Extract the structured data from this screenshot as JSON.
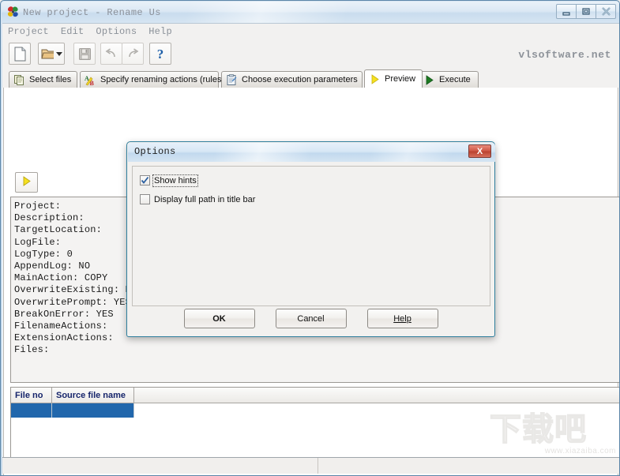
{
  "window": {
    "title": "New project - Rename Us",
    "icon": "app-butterfly-icon",
    "buttons": {
      "minimize": "minimize-icon",
      "maximize": "maximize-icon",
      "close": "close-icon"
    }
  },
  "menubar": {
    "items": [
      {
        "label": "Project"
      },
      {
        "label": "Edit"
      },
      {
        "label": "Options"
      },
      {
        "label": "Help"
      }
    ]
  },
  "toolbar": {
    "buttons": [
      {
        "name": "new-project-button",
        "icon": "new-document-icon",
        "enabled": true
      },
      {
        "name": "open-project-button",
        "icon": "open-folder-icon",
        "enabled": true
      },
      {
        "name": "open-project-dropdown",
        "icon": "chevron-down-icon",
        "enabled": true
      },
      {
        "name": "save-project-button",
        "icon": "save-floppy-icon",
        "enabled": false
      },
      {
        "name": "undo-button",
        "icon": "undo-arrow-icon",
        "enabled": false
      },
      {
        "name": "redo-button",
        "icon": "redo-arrow-icon",
        "enabled": false
      },
      {
        "name": "help-button",
        "icon": "question-mark-icon",
        "enabled": true
      }
    ],
    "brand": "vlsoftware.net"
  },
  "tabs": [
    {
      "label": "Select files",
      "icon": "documents-icon",
      "active": false
    },
    {
      "label": "Specify renaming actions (rules)",
      "icon": "ab-letters-icon",
      "active": false
    },
    {
      "label": "Choose execution parameters",
      "icon": "clipboard-icon",
      "active": false
    },
    {
      "label": "Preview",
      "icon": "yellow-play-icon",
      "active": true
    },
    {
      "label": "Execute",
      "icon": "green-play-icon",
      "active": false
    }
  ],
  "preview": {
    "run_button": {
      "name": "run-preview-button",
      "icon": "yellow-play-icon"
    },
    "memo_lines": [
      "Project:",
      "Description:",
      "TargetLocation:",
      "LogFile:",
      "LogType: 0",
      "AppendLog: NO",
      "MainAction: COPY",
      "OverwriteExisting: NO",
      "OverwritePrompt: YES",
      "BreakOnError: YES",
      "FilenameActions:",
      "ExtensionActions:",
      "Files:"
    ],
    "grid": {
      "columns": [
        {
          "label": "File no",
          "width": 52
        },
        {
          "label": "Source file name",
          "width": 104
        }
      ],
      "rows": [
        [
          "",
          ""
        ]
      ]
    }
  },
  "statusbar": {
    "panels": [
      "",
      ""
    ]
  },
  "dialog": {
    "title": "Options",
    "close_label": "X",
    "checkboxes": [
      {
        "label": "Show hints",
        "checked": true,
        "focused": true
      },
      {
        "label": "Display full path in title bar",
        "checked": false,
        "focused": false
      }
    ],
    "buttons": [
      {
        "name": "ok-button",
        "label": "OK",
        "bold": true
      },
      {
        "name": "cancel-button",
        "label": "Cancel",
        "bold": false
      },
      {
        "name": "help-button",
        "label": "Help",
        "bold": false,
        "accel": "H"
      }
    ]
  },
  "watermark": {
    "text": "下载吧",
    "sub": "www.xiazaiba.com"
  },
  "colors": {
    "title_gradient_top": "#e9f1f8",
    "title_gradient_bottom": "#c9dcee",
    "grid_header_text": "#16256b",
    "grid_selected_row": "#2167ac",
    "dialog_border": "#2f7f9e",
    "close_button": "#bb4330",
    "brand_text": "#8d9299"
  }
}
